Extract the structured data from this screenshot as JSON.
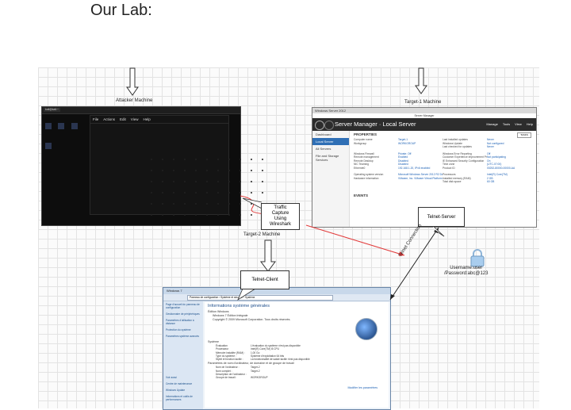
{
  "slide": {
    "title": "Our Lab:"
  },
  "diagram": {
    "attacker_label": "Attacker Machine",
    "target1_label": "Target-1 Machine",
    "target2_label": "Target-2 Machine",
    "telnet_server": "Telnet-Server",
    "telnet_client": "Telnet-Client",
    "traffic_capture": [
      "Traffic",
      "Capture",
      "Using",
      "Wireshark"
    ],
    "telnet_connection": "Telnet Connection",
    "credentials": [
      "Username:user",
      "/Password:abc@123"
    ]
  },
  "attacker_screen": {
    "menu": [
      "File",
      "Actions",
      "Edit",
      "View",
      "Help"
    ],
    "tab_label": "kali@kali:~"
  },
  "server_manager": {
    "window_title": "Windows Server 2012",
    "caption": "Server Manager",
    "header": "Server Manager · Local Server",
    "menu": [
      "Manage",
      "Tools",
      "View",
      "Help"
    ],
    "sidebar": [
      "Dashboard",
      "Local Server",
      "All Servers",
      "File and Storage Services"
    ],
    "properties": "PROPERTIES",
    "events": "EVENTS",
    "tasks": "TASKS",
    "rows": [
      [
        "Computer name",
        "Target-1",
        "Last installed updates",
        "Never"
      ],
      [
        "Workgroup",
        "WORKGROUP",
        "Windows Update",
        "Not configured"
      ],
      [
        "",
        "",
        "Last checked for updates",
        "Never"
      ],
      [
        "Windows Firewall",
        "Private: Off",
        "Windows Error Reporting",
        "Off"
      ],
      [
        "Remote management",
        "Enabled",
        "Customer Experience Improvement Program",
        "Not participating"
      ],
      [
        "Remote Desktop",
        "Disabled",
        "IE Enhanced Security Configuration",
        "On"
      ],
      [
        "NIC Teaming",
        "Disabled",
        "Time zone",
        "(UTC-07:00)"
      ],
      [
        "Ethernet0",
        "192.168.1.20, IPv6 enabled",
        "Product ID",
        "00252-80000-00000-AA"
      ],
      [
        "Operating system version",
        "Microsoft Windows Server 2012 R2 Datacenter Evaluation",
        "Processors",
        "Intel(R) Core(TM)"
      ],
      [
        "Hardware information",
        "VMware, Inc. VMware Virtual Platform",
        "Installed memory (RAM)",
        "2 GB"
      ],
      [
        "",
        "",
        "Total disk space",
        "60 GB"
      ]
    ]
  },
  "windows_client": {
    "title": "Windows 7",
    "address": "Panneau de configuration › Système et sécurité › Système",
    "heading": "Informations système générales",
    "edition_label": "Édition Windows",
    "edition": "Windows 7 Édition Intégrale",
    "copyright": "Copyright © 2009 Microsoft Corporation. Tous droits réservés.",
    "system_label": "Système",
    "sidebar": [
      "Page d'accueil du panneau de configuration",
      "Gestionnaire de périphériques",
      "Paramètres d'utilisation à distance",
      "Protection du système",
      "Paramètres système avancés",
      "Voir aussi",
      "Centre de maintenance",
      "Windows Update",
      "Informations et outils de performances"
    ],
    "system_rows": [
      [
        "Évaluation",
        "L'évaluation du système n'est pas disponible"
      ],
      [
        "Processeur",
        "Intel(R) Core(TM) i5 CPU"
      ],
      [
        "Mémoire installée (RAM) :",
        "1,00 Go"
      ],
      [
        "Type du système :",
        "Système d'exploitation 64 bits"
      ],
      [
        "Stylet et fonction tactile :",
        "La fonctionnalité de saisie tactile n'est pas disponible"
      ]
    ],
    "name_section": "Paramètres de nom d'ordinateur, de domaine et de groupe de travail",
    "name_rows": [
      [
        "Nom de l'ordinateur :",
        "Target-2"
      ],
      [
        "Nom complet :",
        "Target-2"
      ],
      [
        "Description de l'ordinateur :",
        ""
      ],
      [
        "Groupe de travail :",
        "WORKGROUP"
      ]
    ],
    "change_settings": "Modifier les paramètres"
  },
  "colors": {
    "callout_arrow": "#333333",
    "capture_line": "#e23b3b",
    "link_blue": "#1a5fb4"
  }
}
